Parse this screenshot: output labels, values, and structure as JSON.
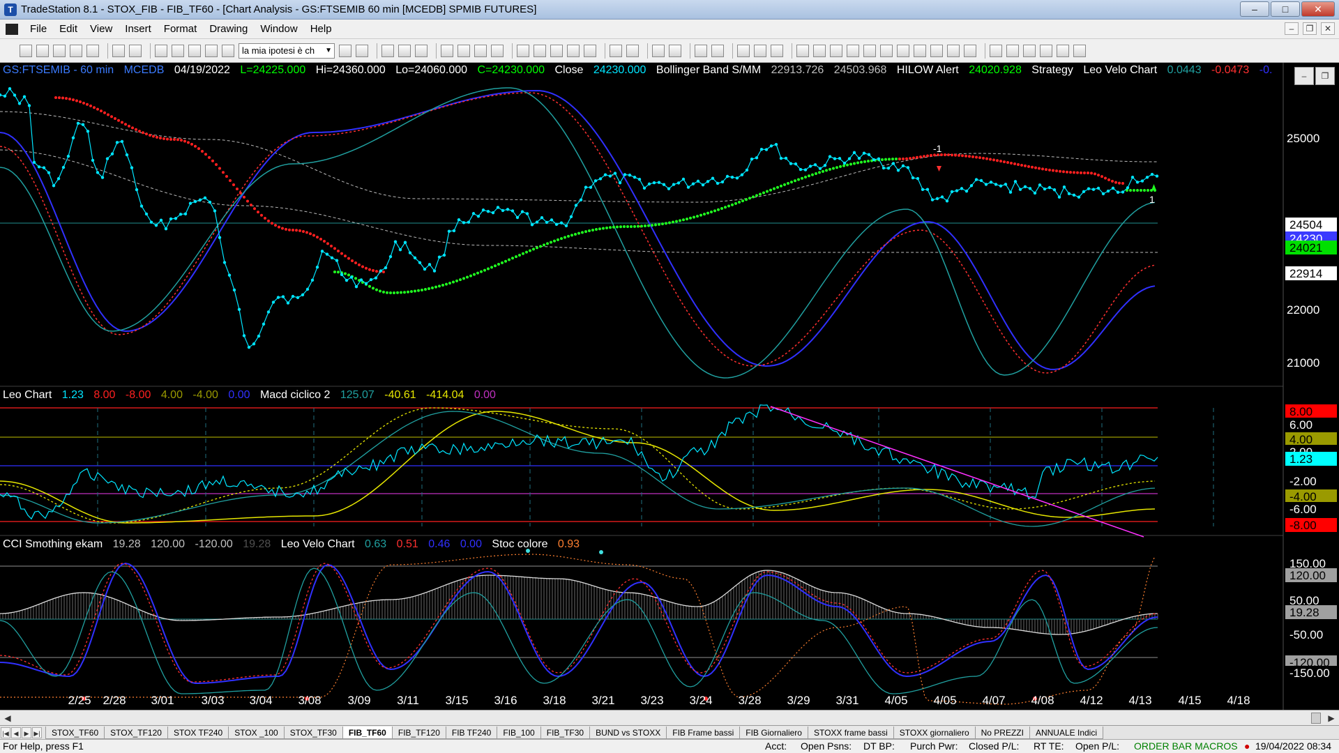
{
  "window": {
    "title": "TradeStation 8.1 - STOX_FIB - FIB_TF60 - [Chart Analysis - GS:FTSEMIB  60 min  [MCEDB] SPMIB FUTURES]",
    "app_icon": "tradestation-icon",
    "minimize_label": "–",
    "maximize_label": "□",
    "close_label": "✕"
  },
  "menu": {
    "items": [
      "File",
      "Edit",
      "View",
      "Insert",
      "Format",
      "Drawing",
      "Window",
      "Help"
    ],
    "mdi_minimize": "–",
    "mdi_restore": "❐",
    "mdi_close": "✕"
  },
  "toolbar": {
    "combo_value": "la mia ipotesi è ch",
    "combo_arrow": "▼"
  },
  "price_pane": {
    "header": {
      "symbol": "GS:FTSEMIB - 60 min",
      "feed": "MCEDB",
      "date": "04/19/2022",
      "low_open": "L=24225.000",
      "high": "Hi=24360.000",
      "low": "Lo=24060.000",
      "close": "C=24230.000",
      "close_label": "Close",
      "close_value": "24230.000",
      "bb_label": "Bollinger Band S/MM",
      "bb_upper": "22913.726",
      "bb_lower": "24503.968",
      "hilow_label": "HILOW Alert",
      "hilow_value": "24020.928",
      "strategy_label": "Strategy",
      "leovelo_label": "Leo Velo Chart",
      "leovelo_v1": "0.0443",
      "leovelo_v2": "-0.0473",
      "leovelo_v3": "-0."
    },
    "axis_ticks": [
      "25000",
      "22000",
      "21000"
    ],
    "price_tags": [
      {
        "value": "24504",
        "bg": "#ffffff",
        "fg": "#000000"
      },
      {
        "value": "24230",
        "bg": "#3b3bff",
        "fg": "#ffffff"
      },
      {
        "value": "24021",
        "bg": "#00e000",
        "fg": "#000000"
      },
      {
        "value": "22914",
        "bg": "#ffffff",
        "fg": "#000000"
      }
    ],
    "annotations": [
      "-1",
      "1"
    ]
  },
  "leo_pane": {
    "header": {
      "name": "Leo Chart",
      "v1": "1.23",
      "v2": "8.00",
      "v3": "-8.00",
      "v4": "4.00",
      "v5": "-4.00",
      "v6": "0.00",
      "macd_label": "Macd ciclico 2",
      "m1": "125.07",
      "m2": "-40.61",
      "m3": "-414.04",
      "m4": "0.00"
    },
    "axis_tags": [
      {
        "value": "8.00",
        "bg": "#ff0000",
        "fg": "#000000"
      },
      {
        "value": "6.00",
        "bg": "#000000",
        "fg": "#ffffff"
      },
      {
        "value": "4.00",
        "bg": "#9a9a00",
        "fg": "#000000"
      },
      {
        "value": "2.00",
        "bg": "#000000",
        "fg": "#ffffff"
      },
      {
        "value": "1.23",
        "bg": "#00ffff",
        "fg": "#000000"
      },
      {
        "value": "-2.00",
        "bg": "#000000",
        "fg": "#ffffff"
      },
      {
        "value": "-4.00",
        "bg": "#9a9a00",
        "fg": "#000000"
      },
      {
        "value": "-6.00",
        "bg": "#000000",
        "fg": "#ffffff"
      },
      {
        "value": "-8.00",
        "bg": "#ff0000",
        "fg": "#000000"
      }
    ]
  },
  "cci_pane": {
    "header": {
      "name": "CCI Smothing ekam",
      "v1": "19.28",
      "v2": "120.00",
      "v3": "-120.00",
      "v4": "19.28",
      "velo_label": "Leo Velo Chart",
      "c1": "0.63",
      "c2": "0.51",
      "c3": "0.46",
      "c4": "0.00",
      "stoc_label": "Stoc colore",
      "s1": "0.93"
    },
    "axis_tags": [
      {
        "value": "150.00",
        "bg": "#000000",
        "fg": "#ffffff"
      },
      {
        "value": "120.00",
        "bg": "#a0a0a0",
        "fg": "#000000"
      },
      {
        "value": "50.00",
        "bg": "#000000",
        "fg": "#ffffff"
      },
      {
        "value": "19.28",
        "bg": "#a0a0a0",
        "fg": "#000000"
      },
      {
        "value": "-50.00",
        "bg": "#000000",
        "fg": "#ffffff"
      },
      {
        "value": "-120.00",
        "bg": "#a0a0a0",
        "fg": "#000000"
      },
      {
        "value": "-150.00",
        "bg": "#000000",
        "fg": "#ffffff"
      }
    ]
  },
  "x_axis": {
    "dates": [
      "2/25",
      "2/28",
      "3/01",
      "3/03",
      "3/04",
      "3/08",
      "3/09",
      "3/11",
      "3/15",
      "3/16",
      "3/18",
      "3/21",
      "3/23",
      "3/24",
      "3/28",
      "3/29",
      "3/31",
      "4/05",
      "4/05",
      "4/07",
      "4/08",
      "4/12",
      "4/13",
      "4/15",
      "4/18"
    ]
  },
  "workspace_tabs": {
    "items": [
      "STOX_TF60",
      "STOX_TF120",
      "STOX TF240",
      "STOX _100",
      "STOX_TF30",
      "FIB_TF60",
      "FIB_TF120",
      "FIB TF240",
      "FIB_100",
      "FIB_TF30",
      "BUND vs STOXX",
      "FIB Frame bassi",
      "FIB Giornaliero",
      "STOXX frame bassi",
      "STOXX giornaliero",
      "No PREZZI",
      "ANNUALE Indici"
    ],
    "active_index": 5
  },
  "status_bar": {
    "help": "For Help, press F1",
    "acct": "Acct:",
    "open_psns": "Open Psns:",
    "dt_bp": "DT BP:",
    "purch_pwr": "Purch Pwr:",
    "closed_pl": "Closed P/L:",
    "rt_te": "RT TE:",
    "open_pl": "Open P/L:",
    "macros": "ORDER BAR  MACROS",
    "datetime": "19/04/2022 08:34"
  },
  "colors": {
    "bg": "#000000",
    "price_line": "#00e5ff",
    "stop_red": "#ff2020",
    "stop_green": "#20ff20",
    "blue_wave": "#3030ff",
    "teal_wave": "#20a0a0",
    "red_wave": "#ff3030",
    "yellow": "#e6e600",
    "magenta": "#ff30ff",
    "white": "#ffffff"
  }
}
